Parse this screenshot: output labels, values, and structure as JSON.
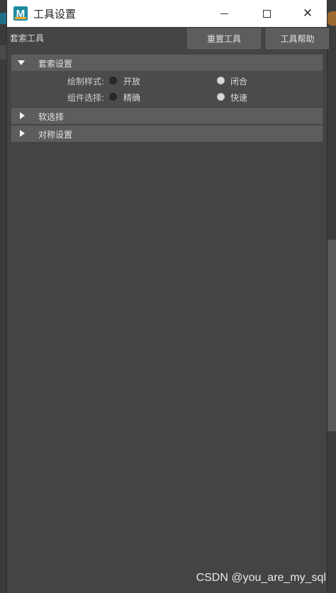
{
  "window": {
    "title": "工具设置",
    "app_icon_letter": "M"
  },
  "toolbar": {
    "tool_name": "套索工具",
    "reset_label": "重置工具",
    "help_label": "工具帮助"
  },
  "sections": [
    {
      "title": "套索设置",
      "expanded": true,
      "options": [
        {
          "label": "绘制样式:",
          "choices": [
            "开放",
            "闭合"
          ],
          "selected": "闭合"
        },
        {
          "label": "组件选择:",
          "choices": [
            "精确",
            "快速"
          ],
          "selected": "快速"
        }
      ]
    },
    {
      "title": "软选择",
      "expanded": false
    },
    {
      "title": "对称设置",
      "expanded": false
    }
  ],
  "watermark": "CSDN @you_are_my_sql",
  "colors": {
    "panel_bg": "#444444",
    "header_bg": "#5d5d5d",
    "accent_icon": "#1d8b9f"
  }
}
